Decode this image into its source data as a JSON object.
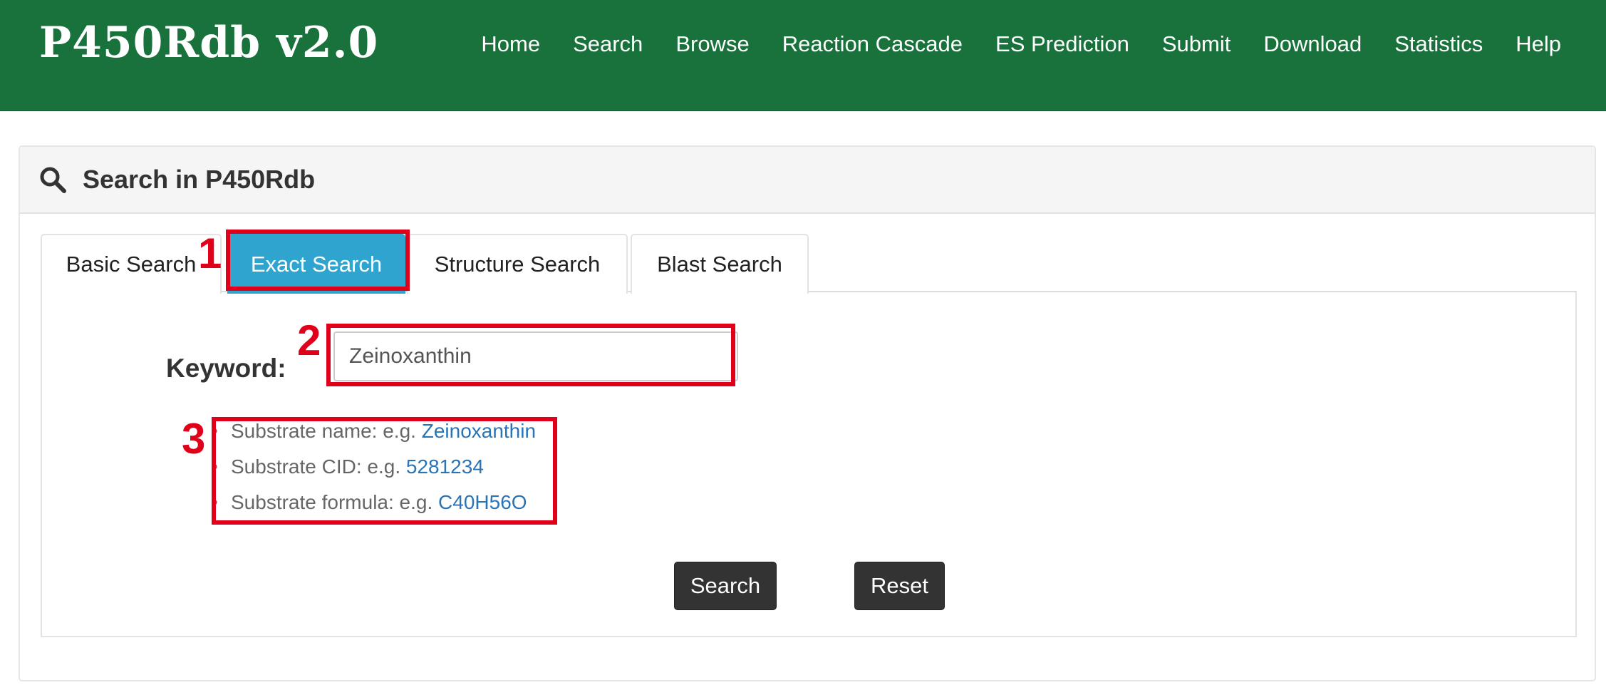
{
  "brand": "P450Rdb v2.0",
  "nav": [
    "Home",
    "Search",
    "Browse",
    "Reaction Cascade",
    "ES Prediction",
    "Submit",
    "Download",
    "Statistics",
    "Help"
  ],
  "panel": {
    "title": "Search in P450Rdb",
    "icon": "search-icon"
  },
  "tabs": [
    "Basic Search",
    "Exact Search",
    "Structure Search",
    "Blast Search"
  ],
  "active_tab": "Exact Search",
  "form": {
    "keyword_label": "Keyword:",
    "keyword_value": "Zeinoxanthin"
  },
  "hints": [
    {
      "text": "Substrate name: e.g. ",
      "example": "Zeinoxanthin"
    },
    {
      "text": "Substrate CID: e.g. ",
      "example": "5281234"
    },
    {
      "text": "Substrate formula: e.g. ",
      "example": "C40H56O"
    }
  ],
  "buttons": {
    "search": "Search",
    "reset": "Reset"
  },
  "annotations": [
    "1",
    "2",
    "3"
  ],
  "colors": {
    "header_green": "#19723b",
    "active_tab": "#2ea4cf",
    "link": "#2a74b5",
    "annotation_red": "#e0001a",
    "button_dark": "#333333"
  }
}
